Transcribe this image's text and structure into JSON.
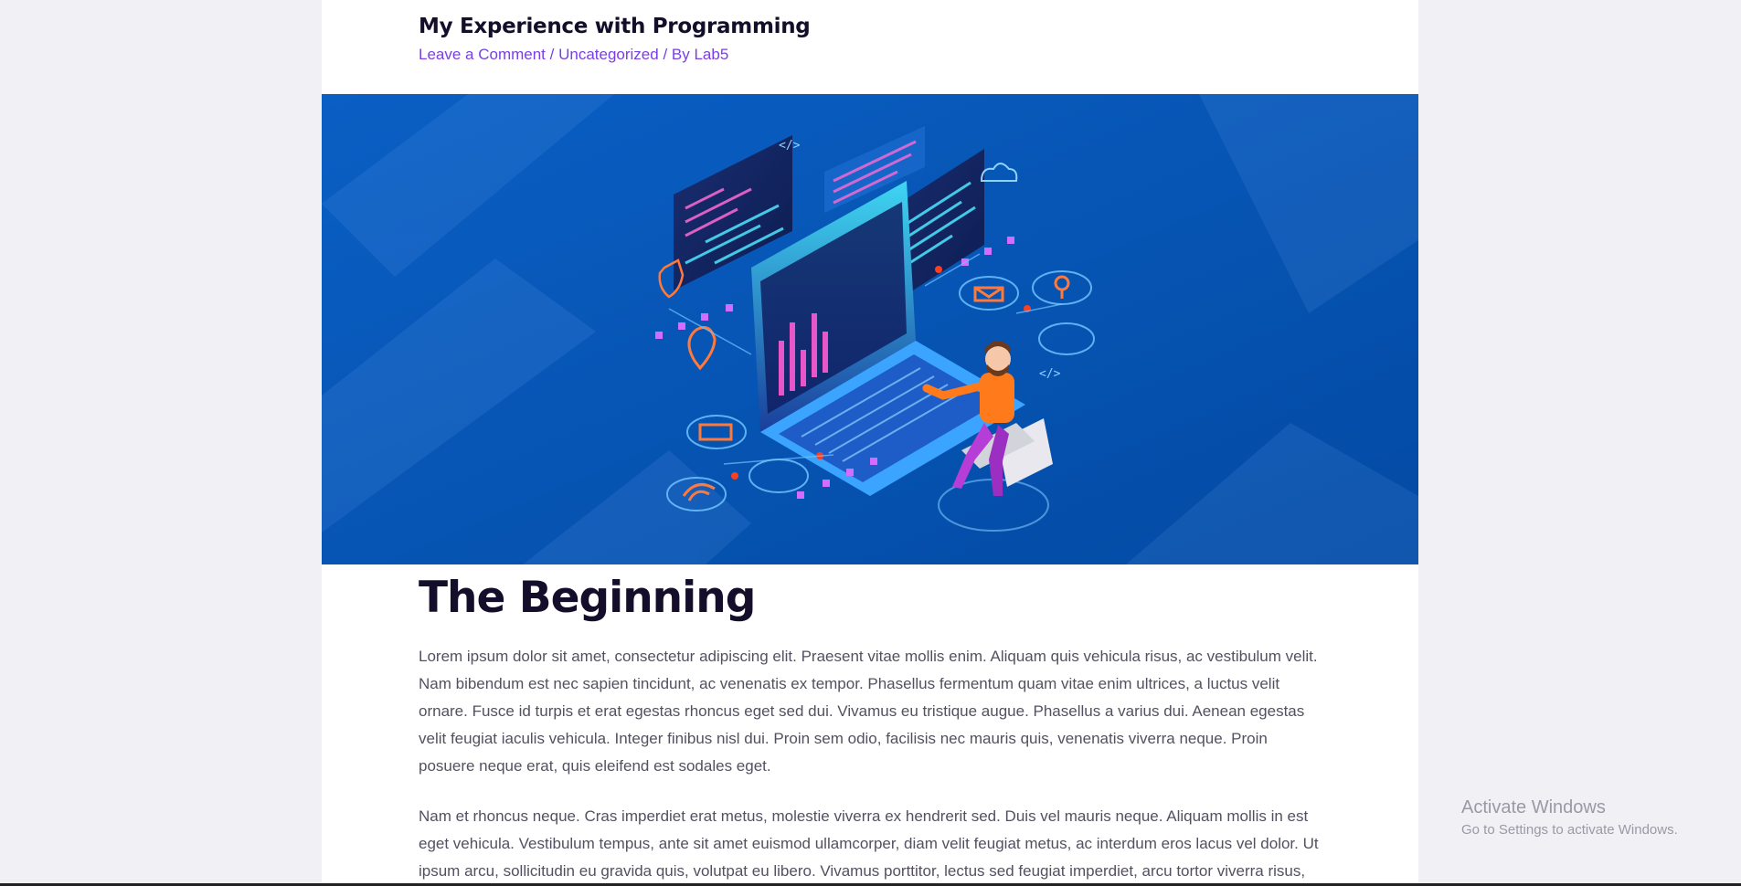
{
  "post": {
    "title": "My Experience with Programming",
    "meta": {
      "comment_link": "Leave a Comment",
      "separator": "/",
      "category_link": "Uncategorized",
      "by_prefix": "By",
      "author_link": "Lab5"
    }
  },
  "hero": {
    "image_alt": "Isometric illustration of a person at a laptop with floating code screens",
    "background_color": "#0555b6",
    "code_tag": "</>"
  },
  "content": {
    "heading": "The Beginning",
    "paragraphs": [
      "Lorem ipsum dolor sit amet, consectetur adipiscing elit. Praesent vitae mollis enim. Aliquam quis vehicula risus, ac vestibulum velit. Nam bibendum est nec sapien tincidunt, ac venenatis ex tempor. Phasellus fermentum quam vitae enim ultrices, a luctus velit ornare. Fusce id turpis et erat egestas rhoncus eget sed dui. Vivamus eu tristique augue. Phasellus a varius dui. Aenean egestas velit feugiat iaculis vehicula. Integer finibus nisl dui. Proin sem odio, facilisis nec mauris quis, venenatis viverra neque. Proin posuere neque erat, quis eleifend est sodales eget.",
      "Nam et rhoncus neque. Cras imperdiet erat metus, molestie viverra ex hendrerit sed. Duis vel mauris neque. Aliquam mollis in est eget vehicula. Vestibulum tempus, ante sit amet euismod ullamcorper, diam velit feugiat metus, ac interdum eros lacus vel dolor. Ut ipsum arcu, sollicitudin eu gravida quis, volutpat eu libero. Vivamus porttitor, lectus sed feugiat imperdiet, arcu tortor viverra risus,"
    ]
  },
  "watermark": {
    "line1": "Activate Windows",
    "line2": "Go to Settings to activate Windows."
  },
  "colors": {
    "accent": "#7a3fe4",
    "heading": "#140e2a",
    "body_text": "#555060",
    "page_bg": "#f0f0f5"
  }
}
